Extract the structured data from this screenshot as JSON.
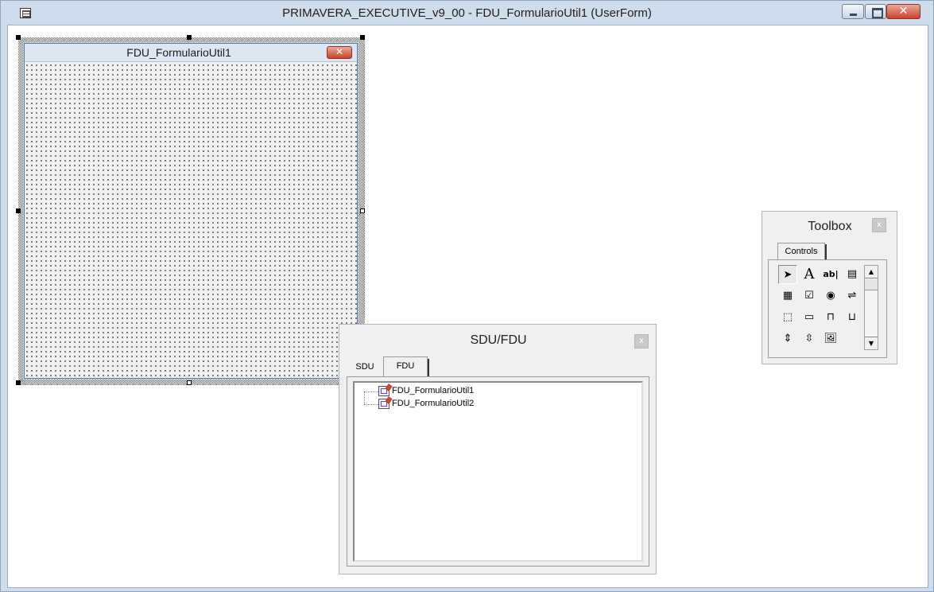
{
  "window": {
    "title": "PRIMAVERA_EXECUTIVE_v9_00 - FDU_FormularioUtil1 (UserForm)",
    "icons": {
      "system": "form-icon",
      "minimize": "minimize-icon",
      "maximize": "maximize-icon",
      "close": "close-icon"
    },
    "close_label": "✕"
  },
  "userform": {
    "title": "FDU_FormularioUtil1",
    "close_label": "✕"
  },
  "sdu_panel": {
    "title": "SDU/FDU",
    "close_label": "x",
    "tabs": [
      {
        "label": "SDU",
        "active": false
      },
      {
        "label": "FDU",
        "active": true
      }
    ],
    "tree_items": [
      {
        "label": "FDU_FormularioUtil1",
        "icon": "userform-icon"
      },
      {
        "label": "FDU_FormularioUtil2",
        "icon": "userform-icon"
      }
    ]
  },
  "toolbox": {
    "title": "Toolbox",
    "close_label": "x",
    "tab": "Controls",
    "tools": [
      {
        "name": "select-objects-icon",
        "glyph": "➤",
        "selected": true
      },
      {
        "name": "label-tool-icon",
        "glyph": "A"
      },
      {
        "name": "textbox-tool-icon",
        "glyph": "ab|"
      },
      {
        "name": "combobox-tool-icon",
        "glyph": "▤"
      },
      {
        "name": "listbox-tool-icon",
        "glyph": "▦"
      },
      {
        "name": "checkbox-tool-icon",
        "glyph": "☑"
      },
      {
        "name": "optionbutton-tool-icon",
        "glyph": "◉"
      },
      {
        "name": "togglebutton-tool-icon",
        "glyph": "⇌"
      },
      {
        "name": "frame-tool-icon",
        "glyph": "⬚"
      },
      {
        "name": "commandbutton-tool-icon",
        "glyph": "▭"
      },
      {
        "name": "tabstrip-tool-icon",
        "glyph": "⊓"
      },
      {
        "name": "multipage-tool-icon",
        "glyph": "⊔"
      },
      {
        "name": "scrollbar-tool-icon",
        "glyph": "⇕"
      },
      {
        "name": "spinbutton-tool-icon",
        "glyph": "⇳"
      },
      {
        "name": "image-tool-icon",
        "glyph": "🖼"
      }
    ],
    "scroll": {
      "up": "▲",
      "down": "▼"
    }
  }
}
